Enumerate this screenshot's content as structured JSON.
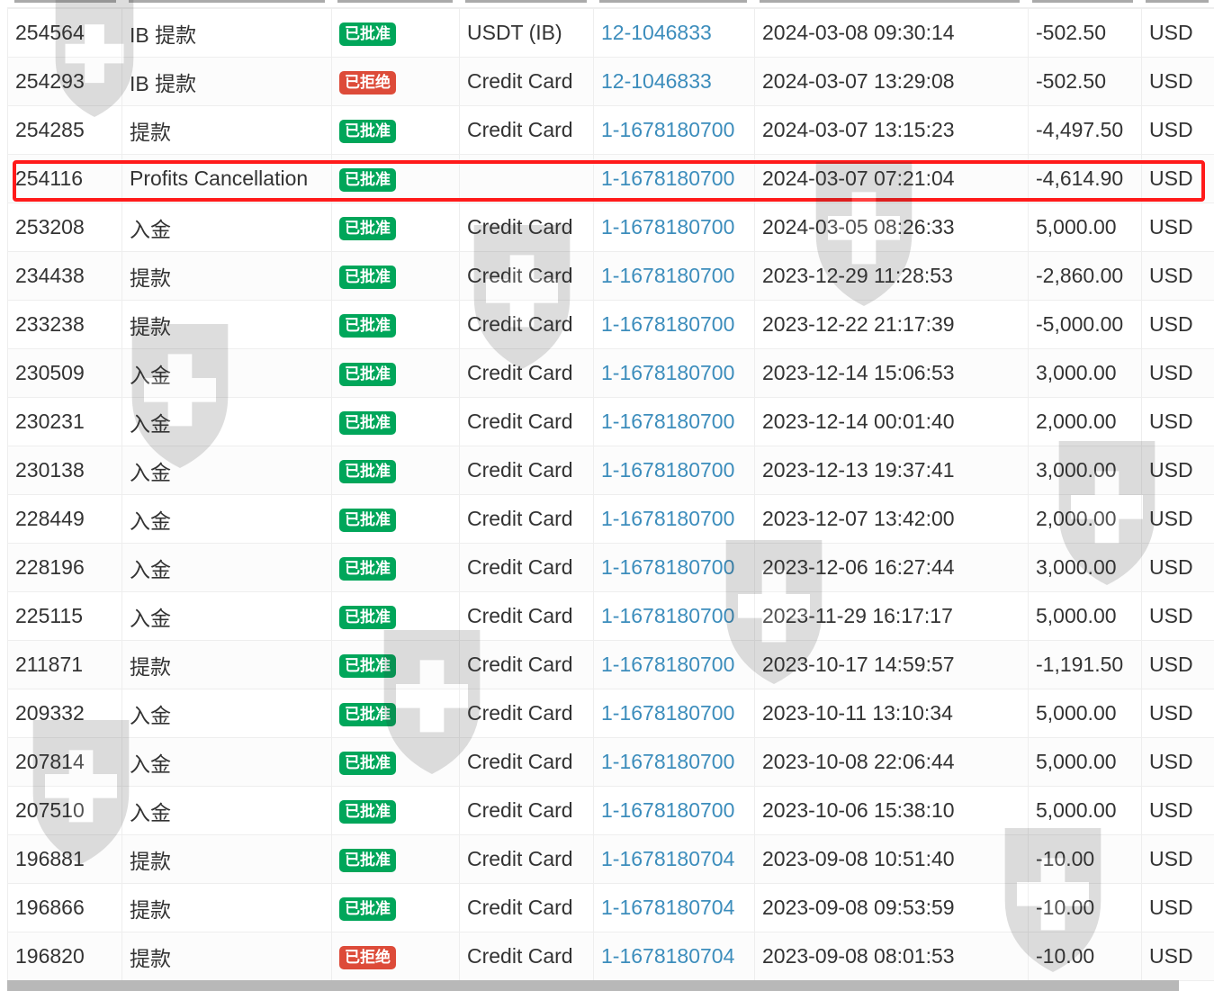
{
  "colors": {
    "approved": "#00a65a",
    "rejected": "#dd4b39",
    "link": "#3c8dbc",
    "highlight": "#ff1a1a"
  },
  "rows": [
    {
      "id": "254564",
      "type": "IB 提款",
      "status": "已批准",
      "status_kind": "ok",
      "method": "USDT (IB)",
      "account": "12-1046833",
      "time": "2024-03-08 09:30:14",
      "amount": "-502.50",
      "currency": "USD"
    },
    {
      "id": "254293",
      "type": "IB 提款",
      "status": "已拒绝",
      "status_kind": "no",
      "method": "Credit Card",
      "account": "12-1046833",
      "time": "2024-03-07 13:29:08",
      "amount": "-502.50",
      "currency": "USD"
    },
    {
      "id": "254285",
      "type": "提款",
      "status": "已批准",
      "status_kind": "ok",
      "method": "Credit Card",
      "account": "1-1678180700",
      "time": "2024-03-07 13:15:23",
      "amount": "-4,497.50",
      "currency": "USD"
    },
    {
      "id": "254116",
      "type": "Profits Cancellation",
      "status": "已批准",
      "status_kind": "ok",
      "method": "",
      "account": "1-1678180700",
      "time": "2024-03-07 07:21:04",
      "amount": "-4,614.90",
      "currency": "USD"
    },
    {
      "id": "253208",
      "type": "入金",
      "status": "已批准",
      "status_kind": "ok",
      "method": "Credit Card",
      "account": "1-1678180700",
      "time": "2024-03-05 08:26:33",
      "amount": "5,000.00",
      "currency": "USD"
    },
    {
      "id": "234438",
      "type": "提款",
      "status": "已批准",
      "status_kind": "ok",
      "method": "Credit Card",
      "account": "1-1678180700",
      "time": "2023-12-29 11:28:53",
      "amount": "-2,860.00",
      "currency": "USD"
    },
    {
      "id": "233238",
      "type": "提款",
      "status": "已批准",
      "status_kind": "ok",
      "method": "Credit Card",
      "account": "1-1678180700",
      "time": "2023-12-22 21:17:39",
      "amount": "-5,000.00",
      "currency": "USD"
    },
    {
      "id": "230509",
      "type": "入金",
      "status": "已批准",
      "status_kind": "ok",
      "method": "Credit Card",
      "account": "1-1678180700",
      "time": "2023-12-14 15:06:53",
      "amount": "3,000.00",
      "currency": "USD"
    },
    {
      "id": "230231",
      "type": "入金",
      "status": "已批准",
      "status_kind": "ok",
      "method": "Credit Card",
      "account": "1-1678180700",
      "time": "2023-12-14 00:01:40",
      "amount": "2,000.00",
      "currency": "USD"
    },
    {
      "id": "230138",
      "type": "入金",
      "status": "已批准",
      "status_kind": "ok",
      "method": "Credit Card",
      "account": "1-1678180700",
      "time": "2023-12-13 19:37:41",
      "amount": "3,000.00",
      "currency": "USD"
    },
    {
      "id": "228449",
      "type": "入金",
      "status": "已批准",
      "status_kind": "ok",
      "method": "Credit Card",
      "account": "1-1678180700",
      "time": "2023-12-07 13:42:00",
      "amount": "2,000.00",
      "currency": "USD"
    },
    {
      "id": "228196",
      "type": "入金",
      "status": "已批准",
      "status_kind": "ok",
      "method": "Credit Card",
      "account": "1-1678180700",
      "time": "2023-12-06 16:27:44",
      "amount": "3,000.00",
      "currency": "USD"
    },
    {
      "id": "225115",
      "type": "入金",
      "status": "已批准",
      "status_kind": "ok",
      "method": "Credit Card",
      "account": "1-1678180700",
      "time": "2023-11-29 16:17:17",
      "amount": "5,000.00",
      "currency": "USD"
    },
    {
      "id": "211871",
      "type": "提款",
      "status": "已批准",
      "status_kind": "ok",
      "method": "Credit Card",
      "account": "1-1678180700",
      "time": "2023-10-17 14:59:57",
      "amount": "-1,191.50",
      "currency": "USD"
    },
    {
      "id": "209332",
      "type": "入金",
      "status": "已批准",
      "status_kind": "ok",
      "method": "Credit Card",
      "account": "1-1678180700",
      "time": "2023-10-11 13:10:34",
      "amount": "5,000.00",
      "currency": "USD"
    },
    {
      "id": "207814",
      "type": "入金",
      "status": "已批准",
      "status_kind": "ok",
      "method": "Credit Card",
      "account": "1-1678180700",
      "time": "2023-10-08 22:06:44",
      "amount": "5,000.00",
      "currency": "USD"
    },
    {
      "id": "207510",
      "type": "入金",
      "status": "已批准",
      "status_kind": "ok",
      "method": "Credit Card",
      "account": "1-1678180700",
      "time": "2023-10-06 15:38:10",
      "amount": "5,000.00",
      "currency": "USD"
    },
    {
      "id": "196881",
      "type": "提款",
      "status": "已批准",
      "status_kind": "ok",
      "method": "Credit Card",
      "account": "1-1678180704",
      "time": "2023-09-08 10:51:40",
      "amount": "-10.00",
      "currency": "USD"
    },
    {
      "id": "196866",
      "type": "提款",
      "status": "已批准",
      "status_kind": "ok",
      "method": "Credit Card",
      "account": "1-1678180704",
      "time": "2023-09-08 09:53:59",
      "amount": "-10.00",
      "currency": "USD"
    },
    {
      "id": "196820",
      "type": "提款",
      "status": "已拒绝",
      "status_kind": "no",
      "method": "Credit Card",
      "account": "1-1678180704",
      "time": "2023-09-08 08:01:53",
      "amount": "-10.00",
      "currency": "USD"
    }
  ]
}
